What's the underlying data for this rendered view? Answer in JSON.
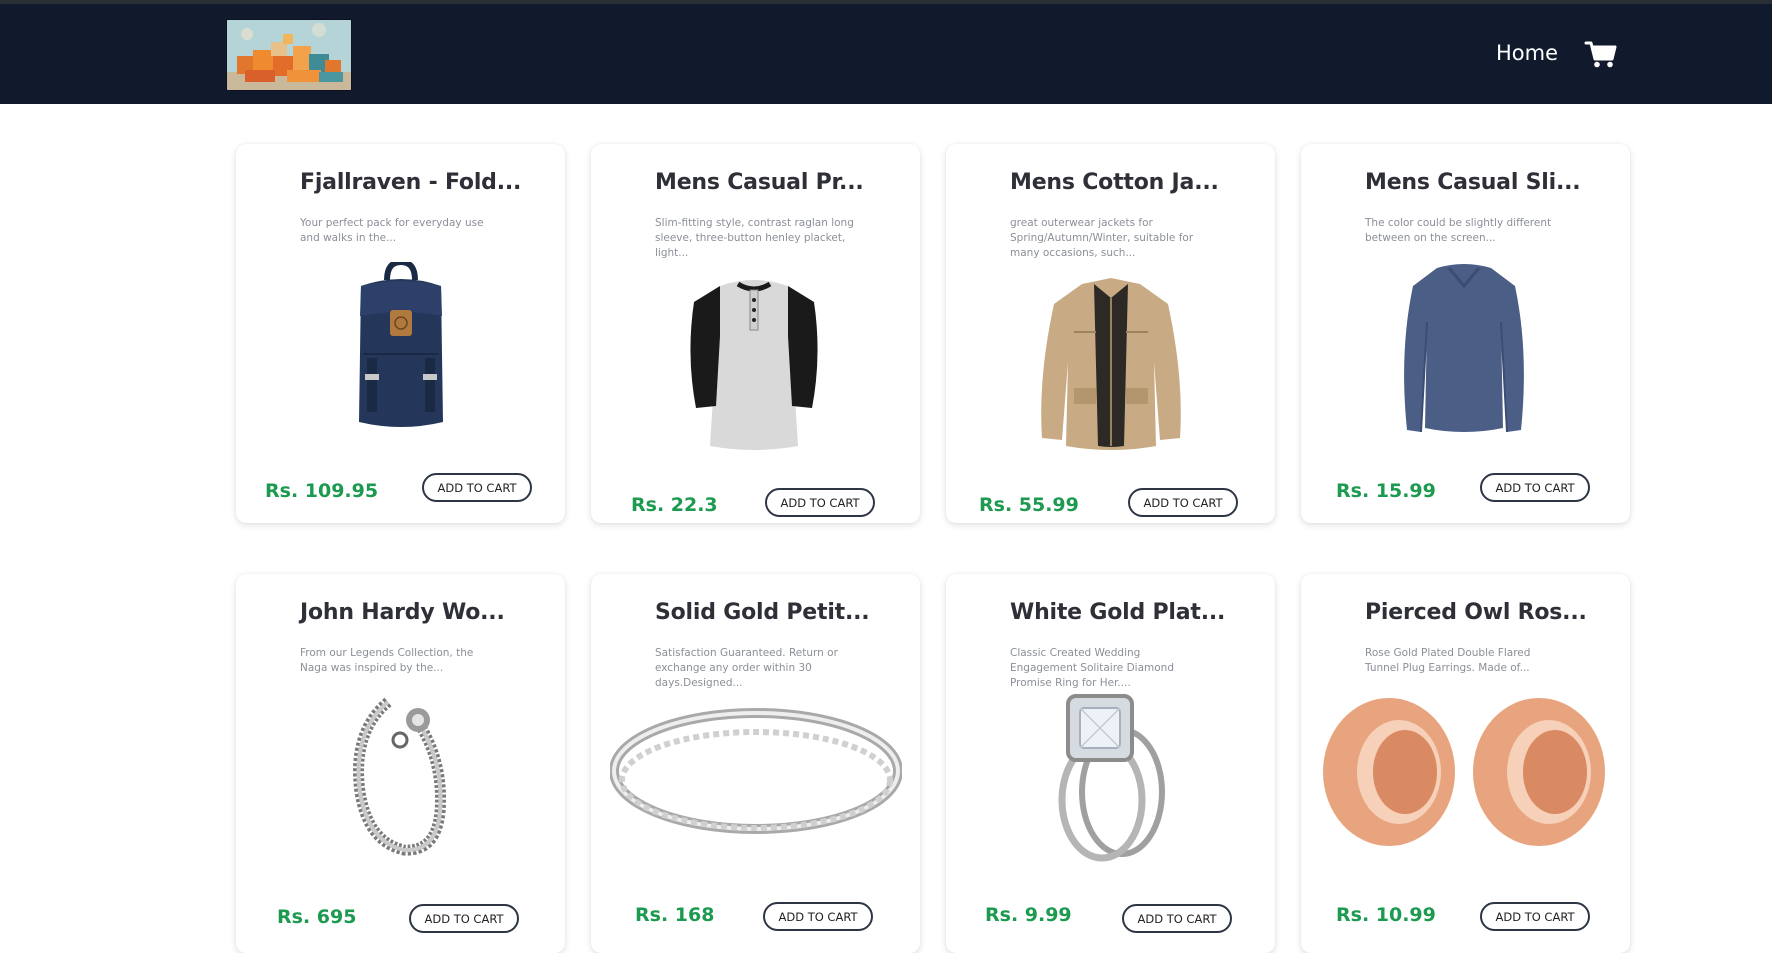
{
  "nav": {
    "home_label": "Home",
    "cart_icon": "shopping-cart-icon"
  },
  "colors": {
    "navbar": "#111a2c",
    "price": "#1c9a4f",
    "title": "#2e2f37",
    "description": "#8b8f98"
  },
  "products": [
    {
      "title": "Fjallraven - Fold...",
      "description": "Your perfect pack for everyday use and walks in the...",
      "price": "Rs. 109.95",
      "button": "ADD TO CART",
      "image": "backpack"
    },
    {
      "title": "Mens Casual Pr...",
      "description": "Slim-fitting style, contrast raglan long sleeve, three-button henley placket, light...",
      "price": "Rs. 22.3",
      "button": "ADD TO CART",
      "image": "raglan-tee"
    },
    {
      "title": "Mens Cotton Ja...",
      "description": "great outerwear jackets for Spring/Autumn/Winter, suitable for many occasions, such...",
      "price": "Rs. 55.99",
      "button": "ADD TO CART",
      "image": "cotton-jacket"
    },
    {
      "title": "Mens Casual Sli...",
      "description": "The color could be slightly different between on the screen...",
      "price": "Rs. 15.99",
      "button": "ADD TO CART",
      "image": "long-sleeve-shirt"
    },
    {
      "title": "John Hardy Wo...",
      "description": "From our Legends Collection, the Naga was inspired by the...",
      "price": "Rs. 695",
      "button": "ADD TO CART",
      "image": "chain-bracelet"
    },
    {
      "title": "Solid Gold Petit...",
      "description": "Satisfaction Guaranteed. Return or exchange any order within 30 days.Designed...",
      "price": "Rs. 168",
      "button": "ADD TO CART",
      "image": "diamond-band-ring"
    },
    {
      "title": "White Gold Plat...",
      "description": "Classic Created Wedding Engagement Solitaire Diamond Promise Ring for Her....",
      "price": "Rs. 9.99",
      "button": "ADD TO CART",
      "image": "engagement-ring"
    },
    {
      "title": "Pierced Owl Ros...",
      "description": "Rose Gold Plated Double Flared Tunnel Plug Earrings. Made of...",
      "price": "Rs. 10.99",
      "button": "ADD TO CART",
      "image": "tunnel-plug-earrings"
    }
  ]
}
